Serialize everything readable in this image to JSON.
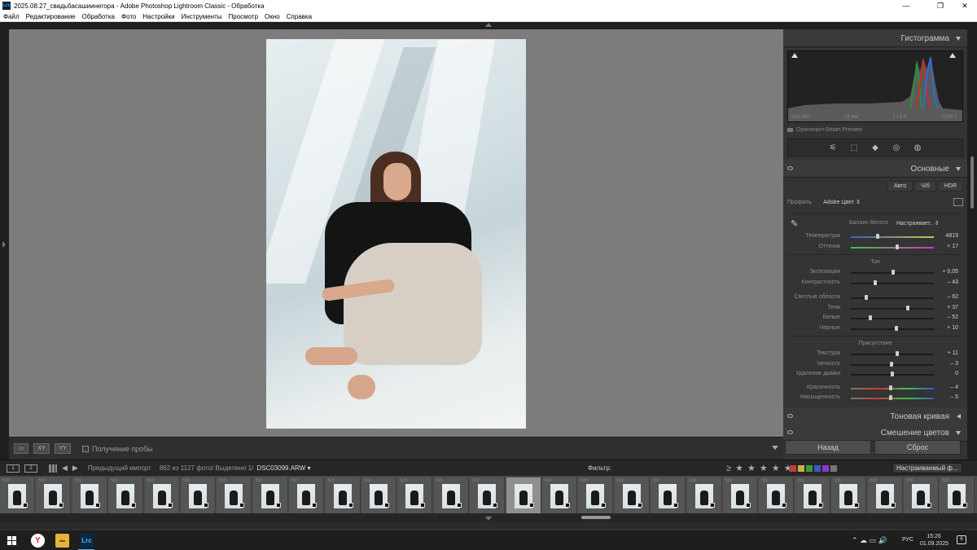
{
  "window": {
    "title": "2025.08.27_свадьбасашиинегора - Adobe Photoshop Lightroom Classic - Обработка",
    "app_icon": "Lrc",
    "minimize": "—",
    "maximize": "❐",
    "close": "✕"
  },
  "menu": [
    "Файл",
    "Редактирование",
    "Обработка",
    "Фото",
    "Настройки",
    "Инструменты",
    "Просмотр",
    "Окно",
    "Справка"
  ],
  "view_toolbar": {
    "loupe_btn": "▭",
    "compare_btn": "XY",
    "survey_btn": "YY",
    "soft_proof_label": "Получение пробы"
  },
  "histogram": {
    "title": "Гистограмма",
    "iso": "ISO 250",
    "focal": "28 мм",
    "aperture": "ƒ / 5,6",
    "shutter": "1/200 с",
    "preview_label": "Оригинал+Smart Preview"
  },
  "tools": [
    "⚟",
    "⬚",
    "◆",
    "◎",
    "◍"
  ],
  "basic": {
    "title": "Основные",
    "buttons": [
      "Авто",
      "Ч/б",
      "HDR"
    ],
    "profile_label": "Профиль",
    "profile_value": "Adobe Цвет ⇕",
    "wb_label": "Баланс белого",
    "wb_value": "Настраивает.. ⇕",
    "wb_sliders": [
      {
        "label": "Температура",
        "value": "4819",
        "pos": 0.32
      },
      {
        "label": "Оттенок",
        "value": "+ 17",
        "pos": 0.56
      }
    ],
    "tone_label": "Тон",
    "tone_sliders": [
      {
        "label": "Экспозиция",
        "value": "+ 0,05",
        "pos": 0.51
      },
      {
        "label": "Контрастность",
        "value": "– 43",
        "pos": 0.29
      }
    ],
    "tone_sliders2": [
      {
        "label": "Светлые области",
        "value": "– 62",
        "pos": 0.19
      },
      {
        "label": "Тени",
        "value": "+ 37",
        "pos": 0.69
      },
      {
        "label": "Белые",
        "value": "– 52",
        "pos": 0.24
      },
      {
        "label": "Черные",
        "value": "+ 10",
        "pos": 0.55
      }
    ],
    "presence_label": "Присутствие",
    "presence_sliders": [
      {
        "label": "Текстура",
        "value": "+ 11",
        "pos": 0.56
      },
      {
        "label": "Четкость",
        "value": "– 3",
        "pos": 0.49
      },
      {
        "label": "Удаление дымки",
        "value": "0",
        "pos": 0.5
      }
    ],
    "presence_sliders2": [
      {
        "label": "Красочность",
        "value": "– 4",
        "pos": 0.48
      },
      {
        "label": "Насыщенность",
        "value": "– 5",
        "pos": 0.48
      }
    ]
  },
  "tone_curve_title": "Тоновая кривая",
  "color_mix_title": "Смешение цветов",
  "bottom_buttons": {
    "back": "Назад",
    "reset": "Сброс"
  },
  "filmbar": {
    "monitor1": "1",
    "monitor2": "2",
    "prev": "◀",
    "next": "▶",
    "source": "Предыдущий импорт",
    "count": "862 из 1127 фото/ Выделено 1/",
    "file": "DSC03099.ARW ▾",
    "filter_label": "Фильтр:",
    "stars": "≥ ★ ★ ★ ★ ★",
    "preset": "Настраиваемый ф..."
  },
  "filmstrip_numbers": [
    "509",
    "510",
    "511",
    "512",
    "513",
    "514",
    "515",
    "516",
    "517",
    "518",
    "519",
    "520",
    "521",
    "522",
    "523",
    "524",
    "525",
    "526",
    "527",
    "528",
    "529",
    "530",
    "531",
    "532",
    "533",
    "534",
    "535"
  ],
  "filmstrip_selected_index": 14,
  "taskbar": {
    "yandex": "Y",
    "explorer": "▬",
    "lrc": "Lrc",
    "tray": "⌃ ☁ ▭ 🔊",
    "lang": "РУС",
    "time": "15:26",
    "date": "01.09.2025",
    "notif": "6"
  }
}
